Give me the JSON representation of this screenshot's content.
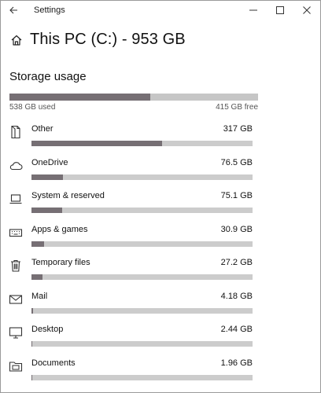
{
  "window": {
    "title": "Settings"
  },
  "header": {
    "title": "This PC (C:) - 953 GB"
  },
  "storage": {
    "section_title": "Storage usage",
    "used_label": "538 GB used",
    "free_label": "415 GB free",
    "used_fraction": 0.565
  },
  "items": [
    {
      "label": "Other",
      "size": "317 GB",
      "fraction": 0.59,
      "icon": "document-icon"
    },
    {
      "label": "OneDrive",
      "size": "76.5 GB",
      "fraction": 0.143,
      "icon": "cloud-icon"
    },
    {
      "label": "System & reserved",
      "size": "75.1 GB",
      "fraction": 0.14,
      "icon": "laptop-icon"
    },
    {
      "label": "Apps & games",
      "size": "30.9 GB",
      "fraction": 0.058,
      "icon": "keyboard-icon"
    },
    {
      "label": "Temporary files",
      "size": "27.2 GB",
      "fraction": 0.051,
      "icon": "trash-icon"
    },
    {
      "label": "Mail",
      "size": "4.18 GB",
      "fraction": 0.008,
      "icon": "mail-icon"
    },
    {
      "label": "Desktop",
      "size": "2.44 GB",
      "fraction": 0.005,
      "icon": "monitor-icon"
    },
    {
      "label": "Documents",
      "size": "1.96 GB",
      "fraction": 0.004,
      "icon": "folder-icon"
    }
  ],
  "colors": {
    "bar_fill": "#766f74",
    "bar_track": "#cccccc"
  }
}
